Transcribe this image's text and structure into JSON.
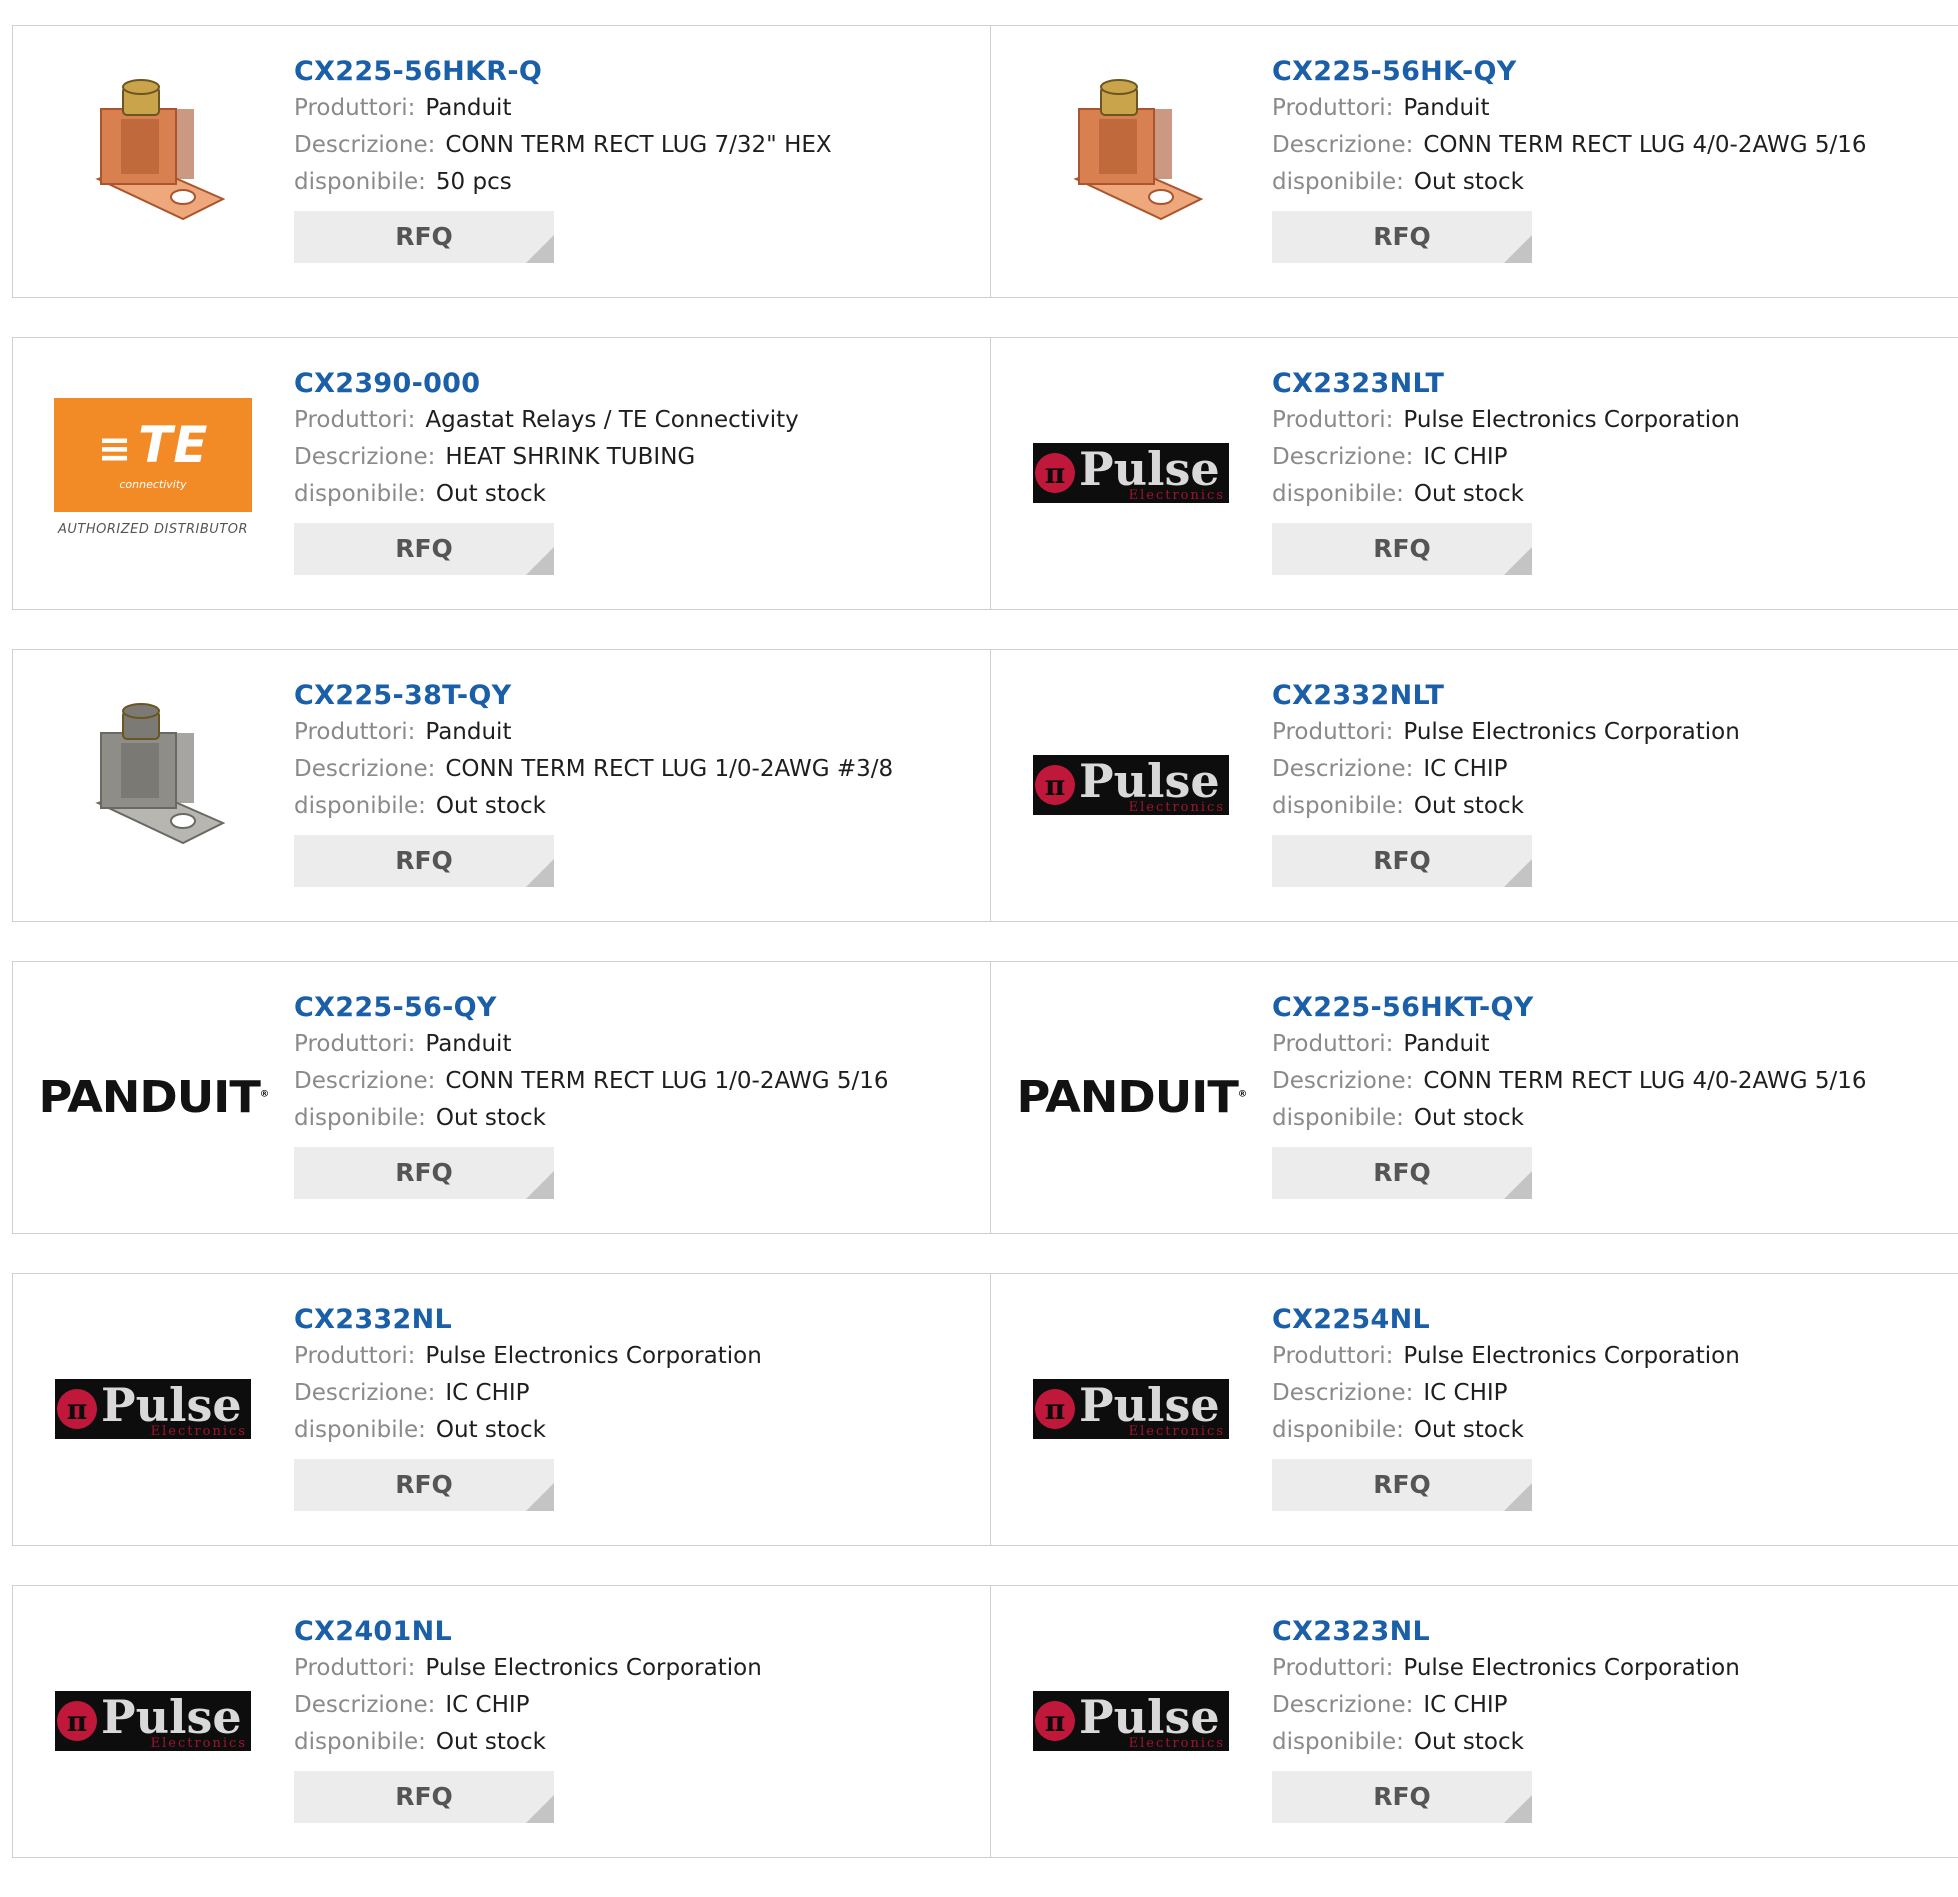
{
  "labels": {
    "manufacturer": "Produttori:",
    "description": "Descrizione:",
    "available": "disponibile:",
    "rfq": "RFQ"
  },
  "logos": {
    "te_word": "TE",
    "te_sub": "connectivity",
    "te_authorized": "AUTHORIZED DISTRIBUTOR",
    "pulse_word": "Pulse",
    "pulse_sub": "Electronics",
    "panduit_word": "PANDUIT"
  },
  "products": [
    {
      "part": "CX225-56HKR-Q",
      "manufacturer": "Panduit",
      "description": "CONN TERM RECT LUG 7/32\" HEX",
      "available": "50 pcs",
      "image": "copper-lug"
    },
    {
      "part": "CX225-56HK-QY",
      "manufacturer": "Panduit",
      "description": "CONN TERM RECT LUG 4/0-2AWG 5/16",
      "available": "Out stock",
      "image": "copper-lug"
    },
    {
      "part": "CX2390-000",
      "manufacturer": "Agastat Relays / TE Connectivity",
      "description": "HEAT SHRINK TUBING",
      "available": "Out stock",
      "image": "te-logo"
    },
    {
      "part": "CX2323NLT",
      "manufacturer": "Pulse Electronics Corporation",
      "description": "IC CHIP",
      "available": "Out stock",
      "image": "pulse-logo"
    },
    {
      "part": "CX225-38T-QY",
      "manufacturer": "Panduit",
      "description": "CONN TERM RECT LUG 1/0-2AWG #3/8",
      "available": "Out stock",
      "image": "tin-lug"
    },
    {
      "part": "CX2332NLT",
      "manufacturer": "Pulse Electronics Corporation",
      "description": "IC CHIP",
      "available": "Out stock",
      "image": "pulse-logo"
    },
    {
      "part": "CX225-56-QY",
      "manufacturer": "Panduit",
      "description": "CONN TERM RECT LUG 1/0-2AWG 5/16",
      "available": "Out stock",
      "image": "panduit-logo"
    },
    {
      "part": "CX225-56HKT-QY",
      "manufacturer": "Panduit",
      "description": "CONN TERM RECT LUG 4/0-2AWG 5/16",
      "available": "Out stock",
      "image": "panduit-logo"
    },
    {
      "part": "CX2332NL",
      "manufacturer": "Pulse Electronics Corporation",
      "description": "IC CHIP",
      "available": "Out stock",
      "image": "pulse-logo"
    },
    {
      "part": "CX2254NL",
      "manufacturer": "Pulse Electronics Corporation",
      "description": "IC CHIP",
      "available": "Out stock",
      "image": "pulse-logo"
    },
    {
      "part": "CX2401NL",
      "manufacturer": "Pulse Electronics Corporation",
      "description": "IC CHIP",
      "available": "Out stock",
      "image": "pulse-logo"
    },
    {
      "part": "CX2323NL",
      "manufacturer": "Pulse Electronics Corporation",
      "description": "IC CHIP",
      "available": "Out stock",
      "image": "pulse-logo"
    }
  ],
  "colors": {
    "part_link": "#1a5fa8",
    "label": "#8a8a8a",
    "copper": "#d98050",
    "tin": "#8f8d88"
  }
}
